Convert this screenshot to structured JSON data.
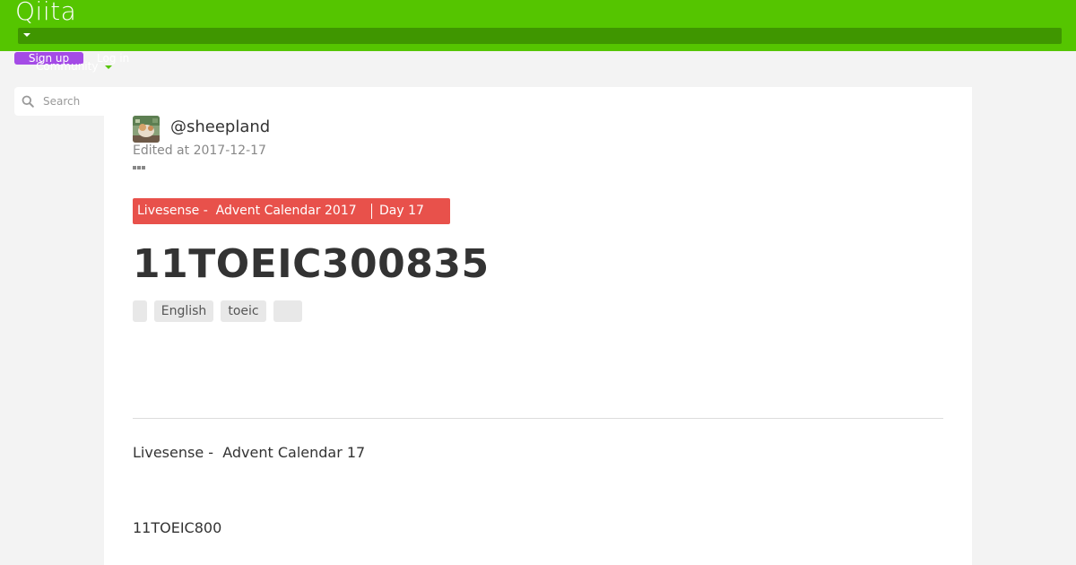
{
  "header": {
    "logo": "Qiita",
    "signup_label": "Sign up",
    "login_label": "Log in",
    "community_label": "Community"
  },
  "search": {
    "placeholder": "Search"
  },
  "article": {
    "author": "@sheepland",
    "edited": "Edited at 2017-12-17",
    "calendar": {
      "name": "Livesense -  Advent Calendar 2017",
      "day": "Day 17"
    },
    "title": "11TOEIC300835",
    "tags": [
      "",
      "English",
      "toeic",
      ""
    ],
    "body": [
      "Livesense -  Advent Calendar 17",
      "11TOEIC800"
    ]
  },
  "colors": {
    "brand": "#55c500",
    "brand_dark": "#3f9600",
    "signup": "#a44be6",
    "calendar": "#e8514b"
  }
}
